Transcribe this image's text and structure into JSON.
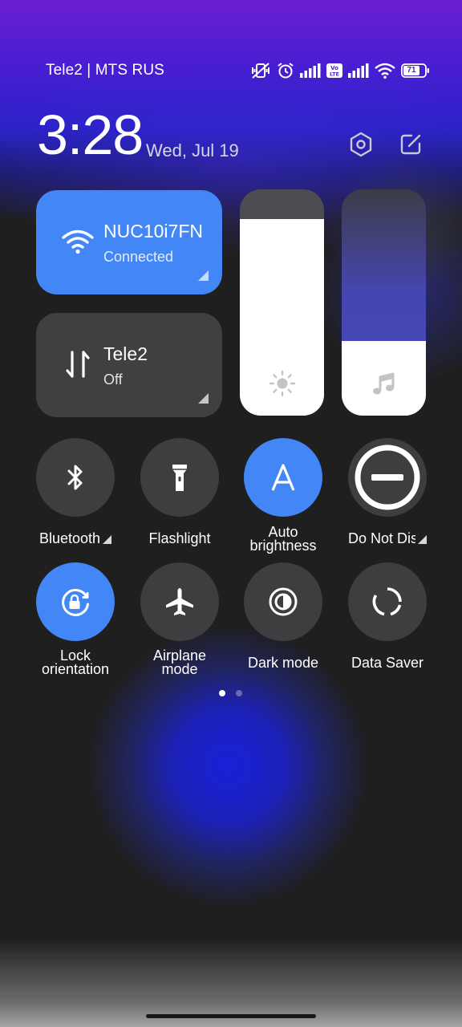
{
  "status_bar": {
    "carrier": "Tele2 | MTS RUS",
    "battery": "71",
    "volte": "Vo LTE",
    "icons": [
      "mute-vibrate-icon",
      "alarm-icon",
      "signal-icon",
      "volte-icon",
      "signal-icon",
      "wifi-icon",
      "battery-icon"
    ]
  },
  "header": {
    "time": "3:28",
    "date": "Wed, Jul 19",
    "settings_icon": "gear-hex-icon",
    "edit_icon": "edit-icon"
  },
  "tiles": {
    "wifi": {
      "title": "NUC10i7FN",
      "status": "Connected",
      "icon": "wifi-icon",
      "active": true
    },
    "mobile_data": {
      "title": "Tele2",
      "status": "Off",
      "icon": "data-arrows-icon",
      "active": false
    }
  },
  "sliders": {
    "brightness": {
      "level": 0.87,
      "icon": "sun-icon"
    },
    "volume": {
      "level": 0.33,
      "icon": "music-note-icon"
    }
  },
  "toggles": {
    "bluetooth": {
      "label": "Bluetooth",
      "active": false,
      "icon": "bluetooth-icon"
    },
    "flashlight": {
      "label": "Flashlight",
      "active": false,
      "icon": "flashlight-icon"
    },
    "auto_brightness": {
      "label_line1": "Auto",
      "label_line2": "brightness",
      "active": true,
      "icon": "auto-brightness-icon"
    },
    "do_not_disturb": {
      "label": "Do Not Disturb",
      "active": false,
      "icon": "do-not-disturb-icon"
    },
    "lock_orientation": {
      "label_line1": "Lock",
      "label_line2": "orientation",
      "active": true,
      "icon": "rotation-lock-icon"
    },
    "airplane_mode": {
      "label_line1": "Airplane",
      "label_line2": "mode",
      "active": false,
      "icon": "airplane-icon"
    },
    "dark_mode": {
      "label": "Dark mode",
      "active": false,
      "icon": "dark-mode-icon"
    },
    "data_saver": {
      "label": "Data Saver",
      "active": false,
      "icon": "data-saver-icon"
    }
  },
  "pager": {
    "pages": 2,
    "current": 1
  },
  "colors": {
    "accent": "#4287f5",
    "tile_inactive": "#3e3e40"
  }
}
